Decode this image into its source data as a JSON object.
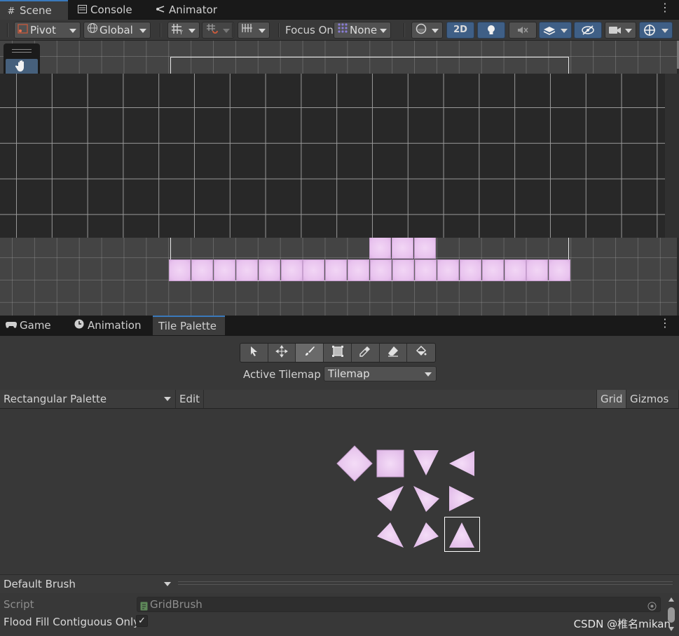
{
  "top_tabs": [
    {
      "label": "Scene",
      "icon": "grid-hash-icon"
    },
    {
      "label": "Console",
      "icon": "console-icon"
    },
    {
      "label": "Animator",
      "icon": "animator-icon"
    }
  ],
  "toolbar": {
    "pivot": "Pivot",
    "global": "Global",
    "focus_label": "Focus On",
    "focus_value": "None",
    "mode_2d": "2D"
  },
  "bottom_tabs": [
    {
      "label": "Game",
      "icon": "gamepad-icon"
    },
    {
      "label": "Animation",
      "icon": "clock-icon"
    },
    {
      "label": "Tile Palette",
      "icon": ""
    }
  ],
  "palette": {
    "active_tilemap_label": "Active Tilemap",
    "active_tilemap_value": "Tilemap",
    "palette_select": "Rectangular Palette",
    "edit": "Edit",
    "grid": "Grid",
    "gizmos": "Gizmos"
  },
  "brush": {
    "select": "Default Brush",
    "script_label": "Script",
    "script_value": "GridBrush",
    "flood_fill_label": "Flood Fill Contiguous Only",
    "flood_fill_checked": true,
    "check_glyph": "✓"
  },
  "watermark": "CSDN @椎名mikan",
  "colors": {
    "accent_blue": "#3a79bb",
    "tile_pink": "#ebcbf0",
    "scene_bg": "#444444",
    "palette_bg": "#282828"
  }
}
